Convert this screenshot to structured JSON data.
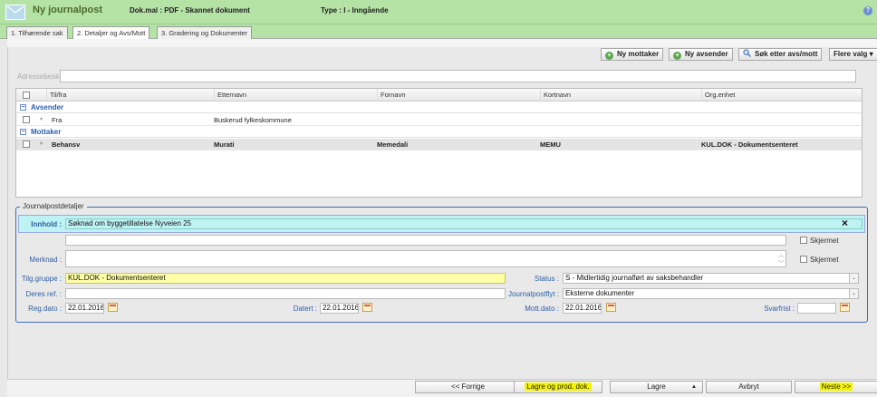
{
  "header": {
    "title": "Ny journalpost",
    "dokmal": "Dok.mal : PDF - Skannet dokument",
    "type": "Type : I - Inngående",
    "help_symbol": "?"
  },
  "tabs": [
    {
      "label": "1. Tilhørende sak"
    },
    {
      "label": "2. Detaljer og Avs/Mott"
    },
    {
      "label": "3. Gradering og Dokumenter"
    }
  ],
  "toolbar": {
    "ny_mottaker": "Ny mottaker",
    "ny_avsender": "Ny avsender",
    "sok": "Søk etter avs/mott",
    "flere_valg": "Flere valg",
    "plus_symbol": "+",
    "dropdown_symbol": "▾"
  },
  "address": {
    "placeholder": "Adressebeskrivelse"
  },
  "grid": {
    "columns": [
      "Til/fra",
      "Etternavn",
      "Fornavn",
      "Kortnavn",
      "Org.enhet"
    ],
    "group_avsender": "Avsender",
    "group_mottaker": "Mottaker",
    "collapse_symbol": "−",
    "row_toggle_symbol": "▾",
    "avsender_row": {
      "tilfra": "Fra",
      "etternavn": "Buskerud fylkeskommune",
      "fornavn": "",
      "kortnavn": "",
      "org": ""
    },
    "mottaker_row": {
      "tilfra": "Behansv",
      "etternavn": "Murati",
      "fornavn": "Memedali",
      "kortnavn": "MEMU",
      "org": "KUL.DOK - Dokumentsenteret"
    }
  },
  "details": {
    "legend": "Journalpostdetaljer",
    "innhold_label": "Innhold :",
    "innhold_value": "Søknad om byggetillatelse Nyveien 25",
    "clear_symbol": "×",
    "skjermet_label": "Skjermet",
    "merknad_label": "Merknad :",
    "tilg_label": "Tilg.gruppe :",
    "tilg_value": "KUL.DOK - Dokumentsenteret",
    "status_label": "Status :",
    "status_value": "S - Midlertidig journalført av saksbehandler",
    "deres_ref_label": "Deres ref. :",
    "journalpostflyt_label": "Journalpostflyt :",
    "journalpostflyt_value": "Eksterne dokumenter",
    "regdato_label": "Reg.dato :",
    "regdato_value": "22.01.2016",
    "datert_label": "Datert :",
    "datert_value": "22.01.2016",
    "mottdato_label": "Mott.dato :",
    "mottdato_value": "22.01.2016",
    "svarfrist_label": "Svarfrist :",
    "select_symbol": "⌄",
    "scroll_up_symbol": "︿",
    "scroll_down_symbol": "﹀"
  },
  "footer": {
    "forrige": "<< Forrige",
    "lagre_prod": "Lagre og prod. dok.",
    "lagre": "Lagre",
    "lagre_arrow": "▲",
    "avbryt": "Avbryt",
    "neste": "Neste >>"
  }
}
